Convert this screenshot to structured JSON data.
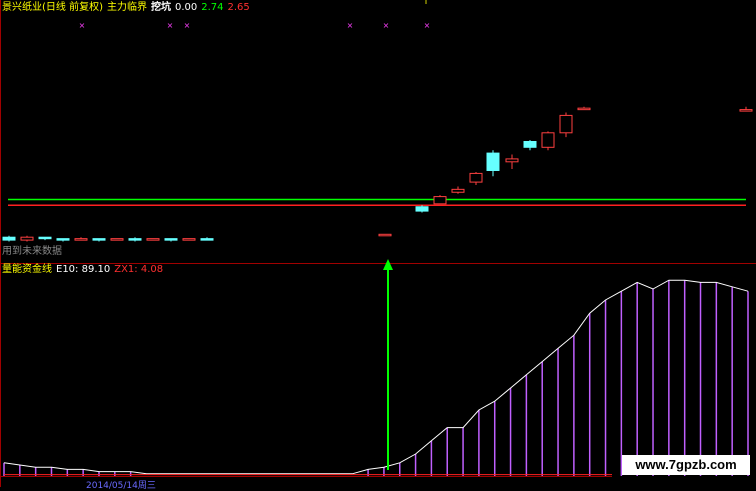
{
  "colors": {
    "background": "#000000",
    "up_candle": "#ff4040",
    "down_candle": "#66ffff",
    "green_line": "#00ff00",
    "red_line": "#ff2020",
    "purple_bar": "#c060ff",
    "white_line": "#ffffff",
    "arrow": "#00ff00",
    "panel_border": "#a00000",
    "yellow_text": "#ffff00",
    "green_text": "#00ff00",
    "red_text": "#ff3030",
    "white_text": "#ffffff",
    "magenta_marker": "#ff40ff"
  },
  "top_panel": {
    "title": "景兴纸业(日线 前复权)",
    "indicator_name": "主力临界",
    "tag": "挖坑",
    "value_0": "0.00",
    "value_1": "2.74",
    "value_2": "2.65",
    "future_note": "用到未来数据"
  },
  "bottom_panel": {
    "title": "量能资金线",
    "e10_label": "E10: 89.10",
    "zx1_label": "ZX1: 4.08",
    "date_fragment": "2014/05/14周三"
  },
  "watermark": "www.7gpzb.com",
  "chart_data": {
    "type": "candlestick",
    "note_labels": [],
    "candles_open_close_high_low": [
      [
        24,
        22,
        25,
        21
      ],
      [
        22,
        24,
        25,
        21
      ],
      [
        24,
        23,
        24,
        22
      ],
      [
        23,
        22,
        23,
        21
      ],
      [
        22,
        23,
        24,
        22
      ],
      [
        23,
        22,
        23,
        21
      ],
      [
        22,
        23,
        23,
        22
      ],
      [
        23,
        22,
        24,
        21
      ],
      [
        22,
        23,
        23,
        22
      ],
      [
        23,
        22,
        23,
        21
      ],
      [
        22,
        23,
        23,
        22
      ],
      [
        23,
        22,
        24,
        22
      ]
    ],
    "right_candles_open_close_high_low": [
      [
        25,
        26,
        26,
        25
      ],
      [
        45,
        42,
        46,
        41
      ],
      [
        47,
        52,
        53,
        47
      ],
      [
        55,
        57,
        59,
        54
      ],
      [
        62,
        68,
        69,
        60
      ],
      [
        82,
        70,
        84,
        66
      ],
      [
        76,
        78,
        81,
        71
      ],
      [
        90,
        86,
        91,
        84
      ],
      [
        86,
        96,
        97,
        84
      ],
      [
        96,
        108,
        110,
        93
      ],
      [
        112,
        113,
        114,
        112
      ],
      [
        112,
        112,
        114,
        111
      ]
    ],
    "green_level": 50,
    "red_level": 46,
    "e10_series": [
      6,
      5,
      4,
      4,
      3,
      3,
      2,
      2,
      2,
      1,
      1,
      1,
      1,
      1,
      1,
      1,
      1,
      1,
      1,
      1,
      1,
      1,
      1,
      3,
      4,
      6,
      10,
      16,
      22,
      22,
      30,
      34,
      40,
      46,
      52,
      58,
      64,
      74,
      80,
      84,
      88,
      85,
      89,
      89,
      88,
      88,
      86,
      84
    ]
  }
}
